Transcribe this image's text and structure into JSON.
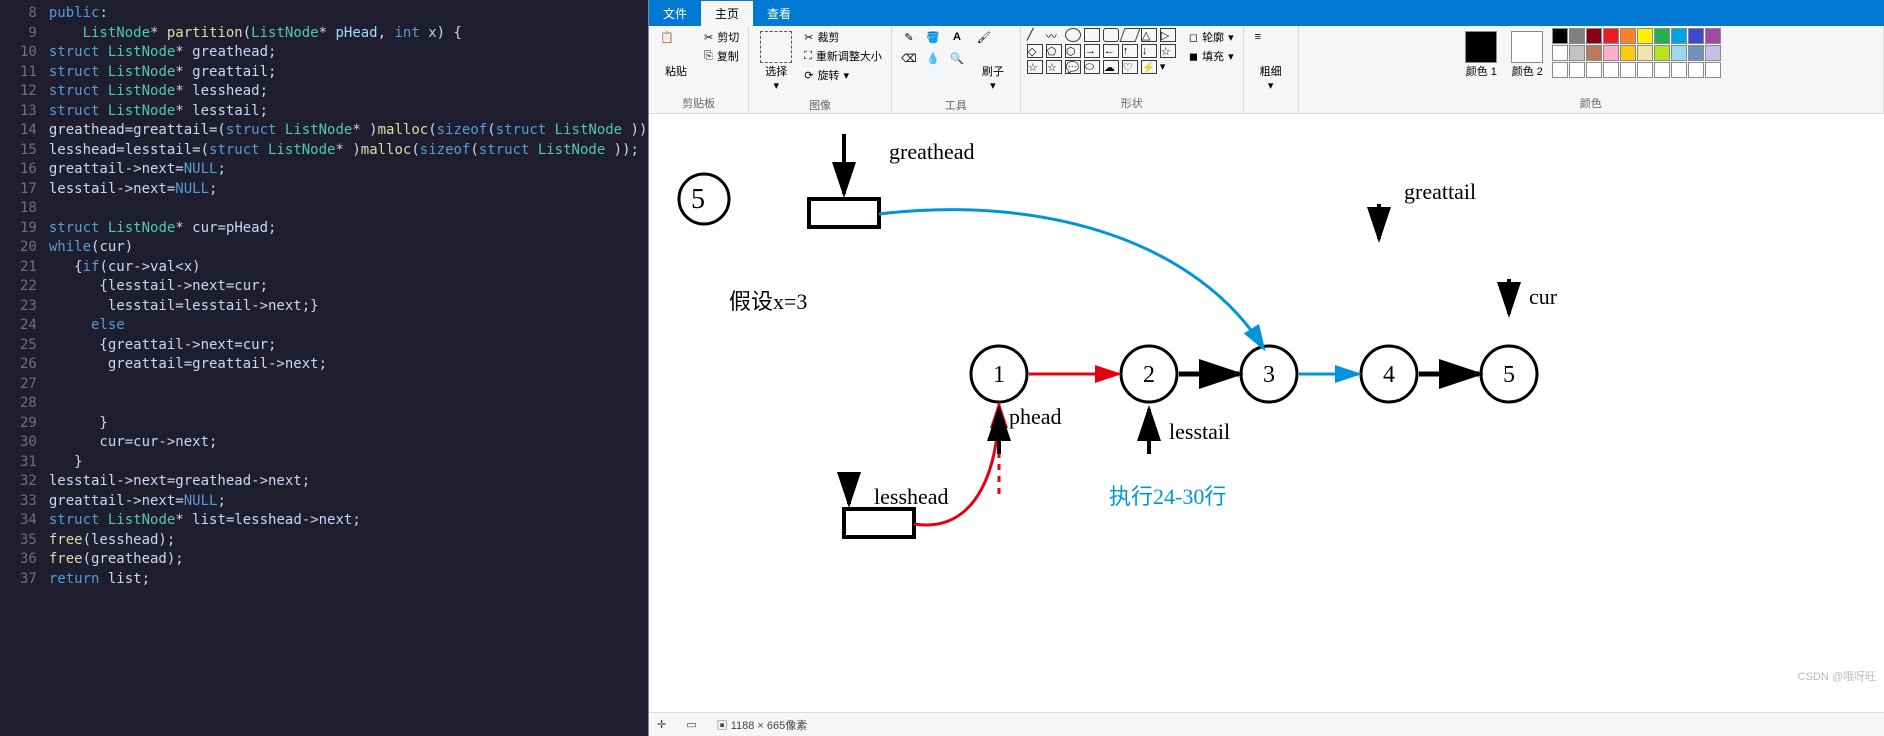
{
  "editor": {
    "lines": [
      {
        "n": 8,
        "html": "<span class='kw'>public</span>:"
      },
      {
        "n": 9,
        "html": "    <span class='ty'>ListNode</span>* <span class='fn'>partition</span>(<span class='ty'>ListNode</span>* <span class='pm'>pHead</span>, <span class='kw'>int</span> <span class='pm'>x</span>) {"
      },
      {
        "n": 10,
        "html": "<span class='kw'>struct</span> <span class='ty'>ListNode</span>* greathead;"
      },
      {
        "n": 11,
        "html": "<span class='kw'>struct</span> <span class='ty'>ListNode</span>* greattail;"
      },
      {
        "n": 12,
        "html": "<span class='kw'>struct</span> <span class='ty'>ListNode</span>* lesshead;"
      },
      {
        "n": 13,
        "html": "<span class='kw'>struct</span> <span class='ty'>ListNode</span>* lesstail;"
      },
      {
        "n": 14,
        "html": "greathead=greattail=(<span class='kw'>struct</span> <span class='ty'>ListNode</span>* )<span class='fn'>malloc</span>(<span class='kw'>sizeof</span>(<span class='kw'>struct</span> <span class='ty'>ListNode</span> ));"
      },
      {
        "n": 15,
        "html": "lesshead=lesstail=(<span class='kw'>struct</span> <span class='ty'>ListNode</span>* )<span class='fn'>malloc</span>(<span class='kw'>sizeof</span>(<span class='kw'>struct</span> <span class='ty'>ListNode</span> ));"
      },
      {
        "n": 16,
        "html": "greattail-&gt;next=<span class='kw'>NULL</span>;"
      },
      {
        "n": 17,
        "html": "lesstail-&gt;next=<span class='kw'>NULL</span>;"
      },
      {
        "n": 18,
        "html": ""
      },
      {
        "n": 19,
        "html": "<span class='kw'>struct</span> <span class='ty'>ListNode</span>* cur=pHead;"
      },
      {
        "n": 20,
        "html": "<span class='kw'>while</span>(cur)"
      },
      {
        "n": 21,
        "html": "   {<span class='kw'>if</span>(cur-&gt;val&lt;x)"
      },
      {
        "n": 22,
        "html": "      {lesstail-&gt;next=cur;"
      },
      {
        "n": 23,
        "html": "       lesstail=lesstail-&gt;next;}"
      },
      {
        "n": 24,
        "html": "     <span class='kw'>else</span>"
      },
      {
        "n": 25,
        "html": "      {greattail-&gt;next=cur;"
      },
      {
        "n": 26,
        "html": "       greattail=greattail-&gt;next;"
      },
      {
        "n": 27,
        "html": ""
      },
      {
        "n": 28,
        "html": ""
      },
      {
        "n": 29,
        "html": "      }"
      },
      {
        "n": 30,
        "html": "      cur=cur-&gt;next;"
      },
      {
        "n": 31,
        "html": "   }"
      },
      {
        "n": 32,
        "html": "lesstail-&gt;next=greathead-&gt;next;"
      },
      {
        "n": 33,
        "html": "greattail-&gt;next=<span class='kw'>NULL</span>;"
      },
      {
        "n": 34,
        "html": "<span class='kw'>struct</span> <span class='ty'>ListNode</span>* list=lesshead-&gt;next;"
      },
      {
        "n": 35,
        "html": "<span class='fn'>free</span>(lesshead);"
      },
      {
        "n": 36,
        "html": "<span class='fn'>free</span>(greathead);"
      },
      {
        "n": 37,
        "html": "<span class='kw'>return</span> list;"
      }
    ]
  },
  "paint": {
    "tabs": {
      "file": "文件",
      "home": "主页",
      "view": "查看"
    },
    "ribbon": {
      "clipboard": {
        "label": "剪贴板",
        "paste": "粘贴",
        "cut": "剪切",
        "copy": "复制"
      },
      "image": {
        "label": "图像",
        "select": "选择",
        "crop": "裁剪",
        "resize": "重新调整大小",
        "rotate": "旋转"
      },
      "tools": {
        "label": "工具",
        "brush": "刷子"
      },
      "shapes": {
        "label": "形状",
        "outline": "轮廓",
        "fill": "填充"
      },
      "stroke": {
        "label": "粗细"
      },
      "colors": {
        "label": "颜色",
        "c1": "颜色 1",
        "c2": "颜色 2"
      }
    },
    "canvas": {
      "step": "5",
      "assume": "假设x=3",
      "greathead": "greathead",
      "greattail": "greattail",
      "cur": "cur",
      "phead": "phead",
      "lesstail": "lesstail",
      "lesshead": "lesshead",
      "exec": "执行24-30行",
      "nodes": [
        "1",
        "2",
        "3",
        "4",
        "5"
      ]
    },
    "status": {
      "dim": "1188 × 665像素"
    },
    "watermark": "CSDN @哦呀旺"
  },
  "palette": [
    "#000000",
    "#7f7f7f",
    "#880015",
    "#ed1c24",
    "#ff7f27",
    "#fff200",
    "#22b14c",
    "#00a2e8",
    "#3f48cc",
    "#a349a4",
    "#ffffff",
    "#c3c3c3",
    "#b97a57",
    "#ffaec9",
    "#ffc90e",
    "#efe4b0",
    "#b5e61d",
    "#99d9ea",
    "#7092be",
    "#c8bfe7",
    "#ffffff",
    "#ffffff",
    "#ffffff",
    "#ffffff",
    "#ffffff",
    "#ffffff",
    "#ffffff",
    "#ffffff",
    "#ffffff",
    "#ffffff"
  ]
}
